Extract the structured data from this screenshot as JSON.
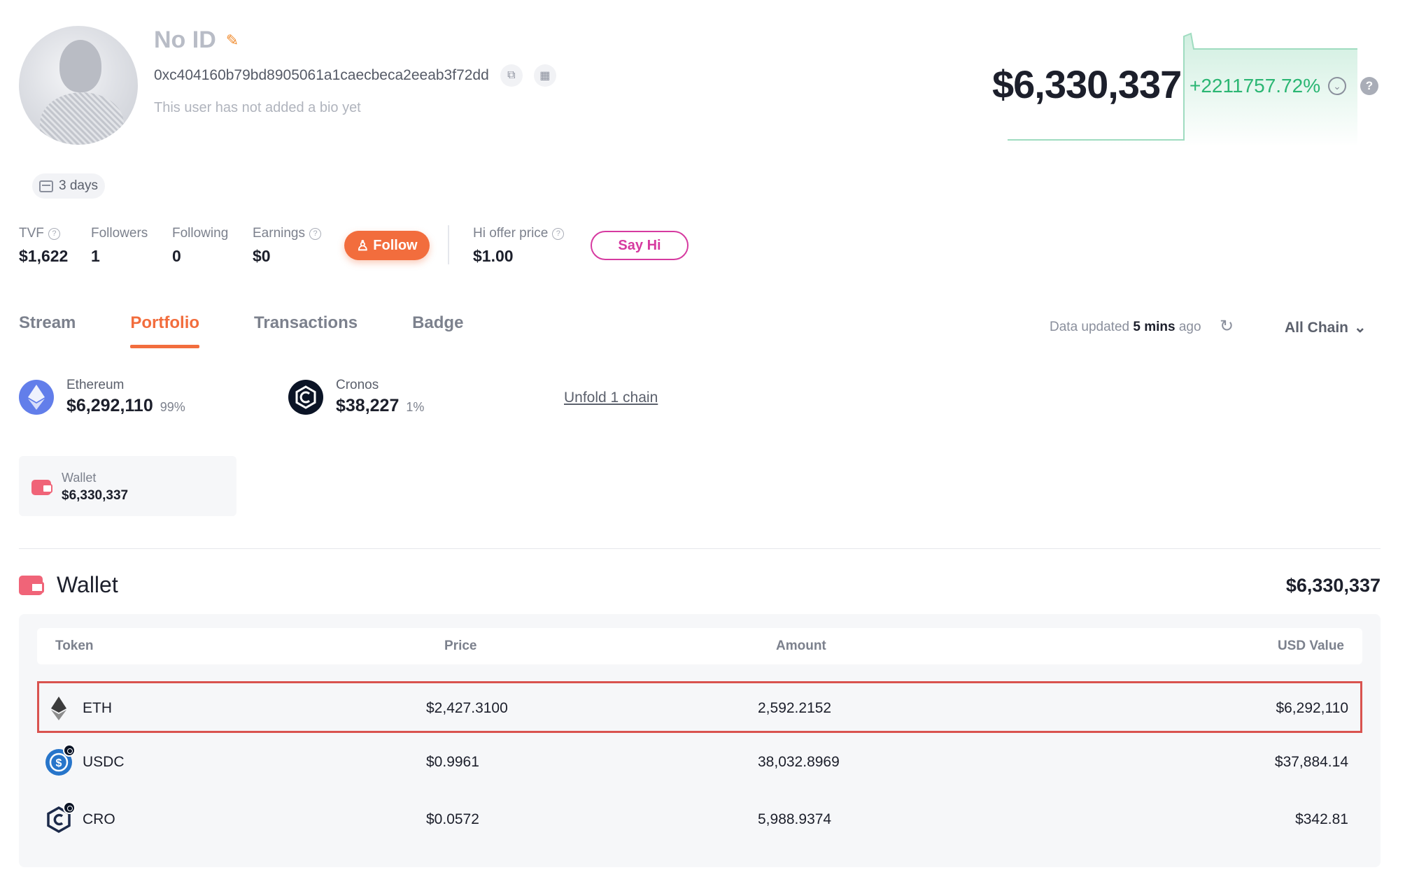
{
  "profile": {
    "name": "No ID",
    "address": "0xc404160b79bd8905061a1caecbeca2eeab3f72dd",
    "bio": "This user has not added a bio yet",
    "days_badge": "3 days"
  },
  "balance": {
    "total": "$6,330,337",
    "change": "+2211757.72%"
  },
  "stats": {
    "tvf": {
      "label": "TVF",
      "value": "$1,622"
    },
    "followers": {
      "label": "Followers",
      "value": "1"
    },
    "following": {
      "label": "Following",
      "value": "0"
    },
    "earnings": {
      "label": "Earnings",
      "value": "$0"
    },
    "follow_button": "Follow",
    "hi_offer": {
      "label": "Hi offer price",
      "value": "$1.00"
    },
    "say_hi_button": "Say Hi"
  },
  "tabs": [
    {
      "label": "Stream"
    },
    {
      "label": "Portfolio",
      "active": true
    },
    {
      "label": "Transactions"
    },
    {
      "label": "Badge"
    }
  ],
  "data_updated": {
    "prefix": "Data updated",
    "time": "5 mins",
    "suffix": "ago"
  },
  "chain_filter": "All Chain",
  "chains": [
    {
      "name": "Ethereum",
      "value": "$6,292,110",
      "percent": "99%"
    },
    {
      "name": "Cronos",
      "value": "$38,227",
      "percent": "1%"
    }
  ],
  "unfold_link": "Unfold 1 chain",
  "wallet_card": {
    "label": "Wallet",
    "value": "$6,330,337"
  },
  "wallet_section": {
    "title": "Wallet",
    "total": "$6,330,337"
  },
  "table": {
    "headers": [
      "Token",
      "Price",
      "Amount",
      "USD Value"
    ],
    "rows": [
      {
        "token": "ETH",
        "price": "$2,427.3100",
        "amount": "2,592.2152",
        "usd": "$6,292,110",
        "highlighted": true
      },
      {
        "token": "USDC",
        "price": "$0.9961",
        "amount": "38,032.8969",
        "usd": "$37,884.14"
      },
      {
        "token": "CRO",
        "price": "$0.0572",
        "amount": "5,988.9374",
        "usd": "$342.81"
      }
    ]
  },
  "colors": {
    "accent": "#f26d3d",
    "positive": "#2bb673",
    "say_hi": "#d63aa0",
    "highlight_border": "#d9534f"
  }
}
